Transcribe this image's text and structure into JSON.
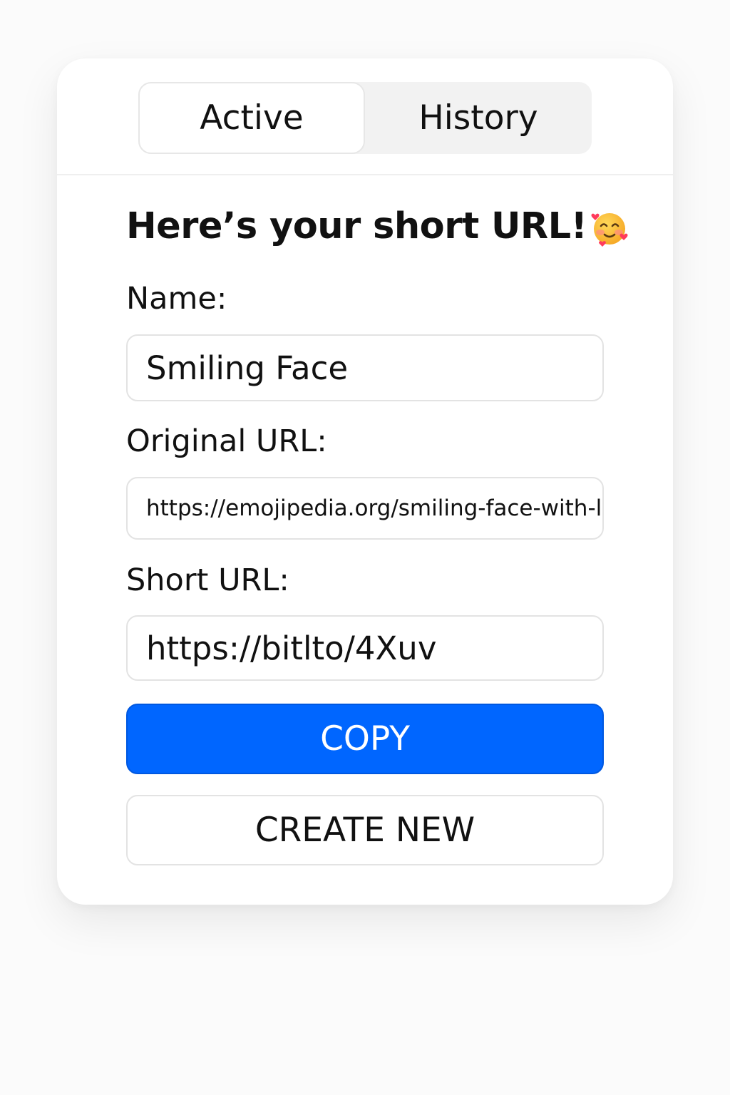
{
  "tabs": {
    "active_label": "Active",
    "history_label": "History"
  },
  "heading": {
    "text": "Here’s your short URL!",
    "emoji_icon": "smiling-face-with-hearts-icon"
  },
  "form": {
    "name_label": "Name:",
    "name_value": "Smiling Face",
    "original_url_label": "Original URL:",
    "original_url_value": "https://emojipedia.org/smiling-face-with-l",
    "short_url_label": "Short URL:",
    "short_url_value": "https://bitlto/4Xuv"
  },
  "actions": {
    "copy_label": "COPY",
    "create_new_label": "CREATE NEW"
  },
  "colors": {
    "accent": "#0066ff",
    "tab_bg": "#f2f2f2",
    "border": "#e3e3e3"
  }
}
